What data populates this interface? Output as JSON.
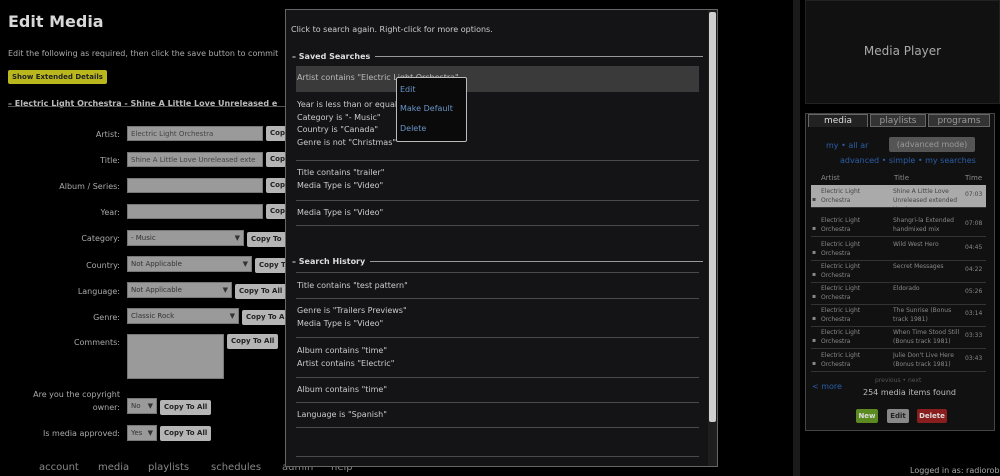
{
  "edit": {
    "title": "Edit Media",
    "description": "Edit the following as required, then click the save button to commit",
    "extended_button": "Show Extended Details",
    "media_heading": "– Electric Light Orchestra - Shine A Little Love Unreleased e",
    "copy_label": "Copy",
    "copy_to": "Copy To",
    "copy_to_all": "Copy To All",
    "fields": {
      "artist": {
        "label": "Artist:",
        "value": "Electric Light Orchestra"
      },
      "title": {
        "label": "Title:",
        "value": "Shine A Little Love Unreleased exte"
      },
      "album": {
        "label": "Album / Series:",
        "value": ""
      },
      "year": {
        "label": "Year:",
        "value": ""
      },
      "category": {
        "label": "Category:",
        "value": "- Music"
      },
      "country": {
        "label": "Country:",
        "value": "Not Applicable"
      },
      "language": {
        "label": "Language:",
        "value": "Not Applicable"
      },
      "genre": {
        "label": "Genre:",
        "value": "Classic Rock"
      },
      "comments": {
        "label": "Comments:",
        "value": ""
      },
      "copyright": {
        "label_1": "Are you the copyright",
        "label_2": "owner:",
        "value": "No"
      },
      "approved": {
        "label": "Is media approved:",
        "value": "Yes"
      }
    }
  },
  "nav": {
    "items": [
      "account",
      "media",
      "playlists",
      "schedules",
      "admin",
      "help"
    ],
    "logged_in": "Logged in as: radiorob"
  },
  "player": {
    "title": "Media Player",
    "tabs": [
      "media",
      "playlists",
      "programs"
    ],
    "subnav_1": "my • all ar",
    "advanced_mode": "(advanced mode)",
    "subnav_2": "advanced • simple • my searches",
    "columns": [
      "Artist",
      "Title",
      "Time"
    ],
    "rows": [
      {
        "artist": "Electric Light Orchestra",
        "title": "Shine A Little Love Unreleased extended Version",
        "time": "07:03",
        "selected": true
      },
      {
        "artist": "Electric Light Orchestra",
        "title": "Shangri-la Extended handmixed mix",
        "time": "07:08"
      },
      {
        "artist": "Electric Light Orchestra",
        "title": "Wild West Hero",
        "time": "04:45"
      },
      {
        "artist": "Electric Light Orchestra",
        "title": "Secret Messages",
        "time": "04:22"
      },
      {
        "artist": "Electric Light Orchestra",
        "title": "Eldorado",
        "time": "05:26"
      },
      {
        "artist": "Electric Light Orchestra",
        "title": "The Sunrise (Bonus track 1981)",
        "time": "03:14"
      },
      {
        "artist": "Electric Light Orchestra",
        "title": "When Time Stood Still (Bonus track 1981)",
        "time": "03:33"
      },
      {
        "artist": "Electric Light Orchestra",
        "title": "Julie Don't Live Here (Bonus track 1981)",
        "time": "03:43"
      }
    ],
    "prev_more": "< more",
    "pagination": "previous • next",
    "count": "254 media items found",
    "buttons": {
      "new": "New",
      "edit": "Edit",
      "delete": "Delete"
    }
  },
  "modal": {
    "intro": "Click to search again. Right-click for more options.",
    "saved_heading": "– Saved Searches",
    "history_heading": "– Search History",
    "saved": [
      [
        "Artist contains \"Electric Light Orchestra\""
      ],
      [
        "Year is less than or equal to",
        "Category is \"- Music\"",
        "Country is \"Canada\"",
        "Genre is not \"Christmas\""
      ],
      [
        "Title contains \"trailer\"",
        "Media Type is \"Video\""
      ],
      [
        "Media Type is \"Video\""
      ]
    ],
    "history": [
      [
        "Title contains \"test pattern\""
      ],
      [
        "Genre is \"Trailers Previews\"",
        "Media Type is \"Video\""
      ],
      [
        "Album contains \"time\"",
        "Artist contains \"Electric\""
      ],
      [
        "Album contains \"time\""
      ],
      [
        "Language is \"Spanish\""
      ]
    ],
    "context_menu": [
      "Edit",
      "Make Default",
      "Delete"
    ]
  }
}
